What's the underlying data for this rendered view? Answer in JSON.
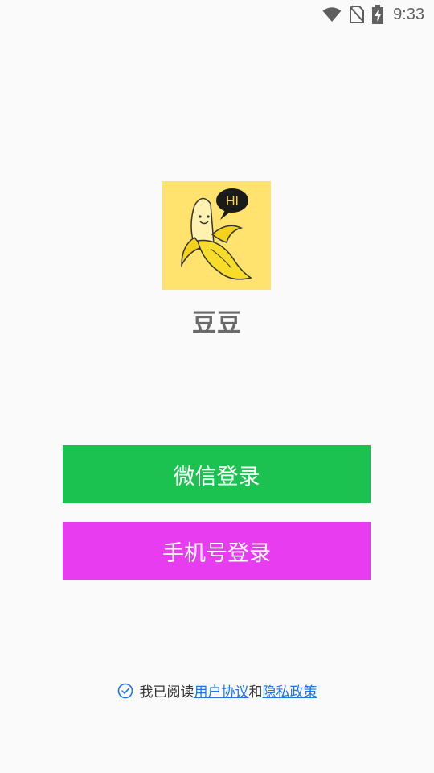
{
  "status_bar": {
    "time": "9:33",
    "icons": [
      "wifi-icon",
      "no-sim-icon",
      "battery-charging-icon"
    ]
  },
  "app": {
    "name": "豆豆",
    "logo": {
      "icon": "banana-hi-logo",
      "speech_text": "HI",
      "background_color": "#ffe36e"
    }
  },
  "buttons": {
    "wechat_login": {
      "label": "微信登录",
      "color": "#1bc250"
    },
    "phone_login": {
      "label": "手机号登录",
      "color": "#e83cf0"
    }
  },
  "agreement": {
    "checkbox_icon": "check-circle-icon",
    "prefix": "我已阅读",
    "user_agreement": "用户协议",
    "conjunction": "和",
    "privacy_policy": "隐私政策",
    "link_color": "#1a73e8"
  }
}
